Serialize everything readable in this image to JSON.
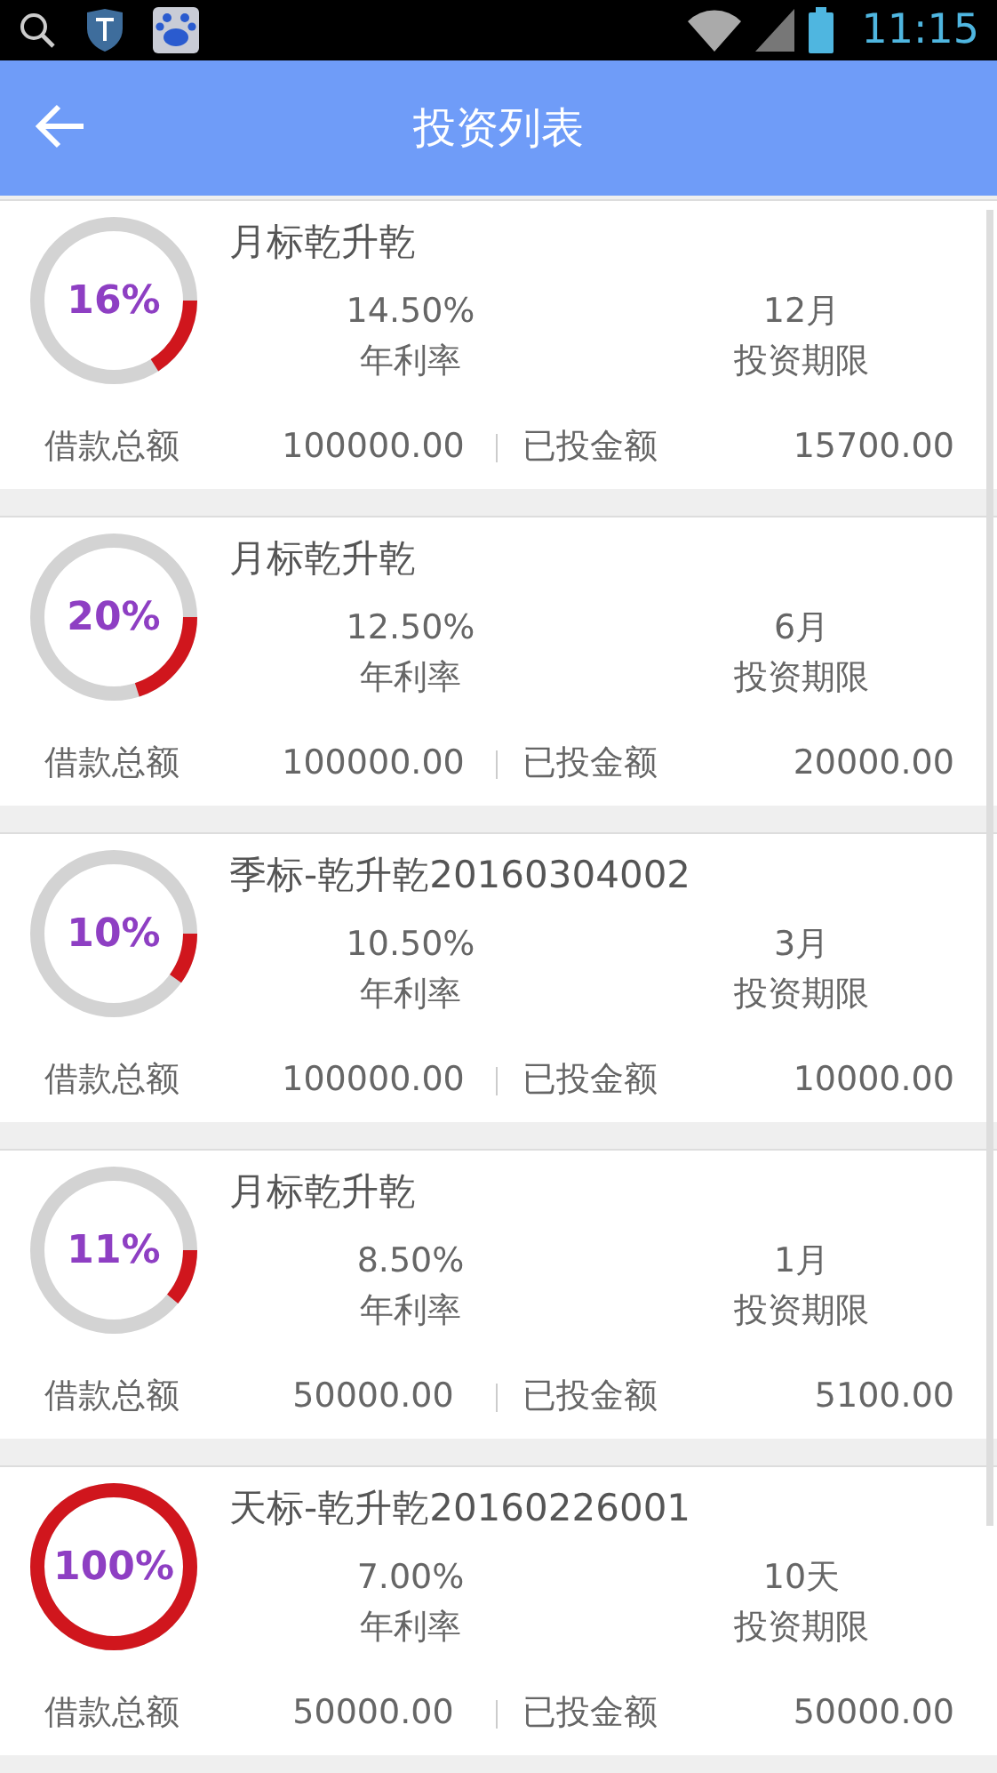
{
  "status_bar": {
    "time": "11:15"
  },
  "header": {
    "title": "投资列表"
  },
  "loans": [
    {
      "name": "月标乾升乾",
      "percent": "16%",
      "level": 0.16,
      "rate": "14.50%",
      "rate_label": "年利率",
      "term": "12月",
      "term_label": "投资期限",
      "total_label": "借款总额",
      "total": "100000.00",
      "invested_label": "已投金额",
      "invested": "15700.00"
    },
    {
      "name": "月标乾升乾",
      "percent": "20%",
      "level": 0.2,
      "rate": "12.50%",
      "rate_label": "年利率",
      "term": "6月",
      "term_label": "投资期限",
      "total_label": "借款总额",
      "total": "100000.00",
      "invested_label": "已投金额",
      "invested": "20000.00"
    },
    {
      "name": "季标-乾升乾20160304002",
      "percent": "10%",
      "level": 0.1,
      "rate": "10.50%",
      "rate_label": "年利率",
      "term": "3月",
      "term_label": "投资期限",
      "total_label": "借款总额",
      "total": "100000.00",
      "invested_label": "已投金额",
      "invested": "10000.00"
    },
    {
      "name": "月标乾升乾",
      "percent": "11%",
      "level": 0.11,
      "rate": "8.50%",
      "rate_label": "年利率",
      "term": "1月",
      "term_label": "投资期限",
      "total_label": "借款总额",
      "total": "50000.00",
      "invested_label": "已投金额",
      "invested": "5100.00"
    },
    {
      "name": "天标-乾升乾20160226001",
      "percent": "100%",
      "level": 1,
      "rate": "7.00%",
      "rate_label": "年利率",
      "term": "10天",
      "term_label": "投资期限",
      "total_label": "借款总额",
      "total": "50000.00",
      "invested_label": "已投金额",
      "invested": "50000.00"
    }
  ]
}
